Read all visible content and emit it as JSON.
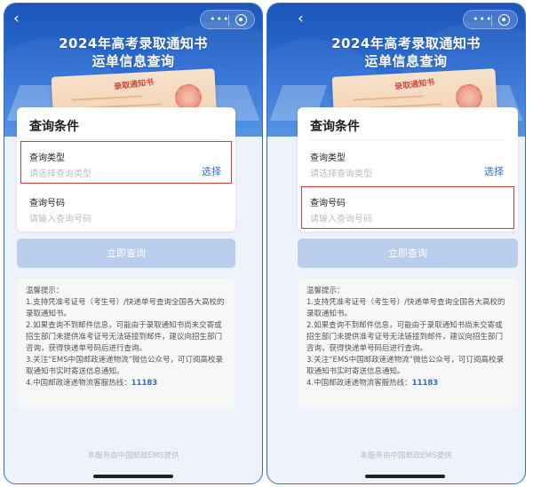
{
  "header": {
    "title_line1": "2024年高考录取通知书",
    "title_line2": "运单信息查询",
    "envelope_text": "录取通知书",
    "back_icon": "‹",
    "more_icon": "•••"
  },
  "form": {
    "card_title": "查询条件",
    "type_label": "查询类型",
    "type_placeholder": "请选择查询类型",
    "choose_label": "选择",
    "number_label": "查询号码",
    "number_placeholder": "请输入查询号码",
    "submit_label": "立即查询"
  },
  "tips": {
    "heading": "温馨提示：",
    "line1": "1.支持凭准考证号（考生号）/快递单号查询全国各大高校的录取通知书。",
    "line2": "2.如果查询不到邮件信息，可能由于录取通知书尚未交寄或招生部门未提供准考证号无法链接到邮件，建议向招生部门咨询，获得快递单号码后进行查询。",
    "line3": "3.关注“EMS中国邮政速递物流”微信公众号，可订阅高校录取通知书实时寄送信息通知。",
    "line4_prefix": "4.中国邮政速递物流客服热线：",
    "hotline": "11183"
  },
  "footer": {
    "text": "本服务由中国邮政EMS提供"
  },
  "colors": {
    "primary": "#2f6bd1",
    "highlight": "#d63a3a",
    "button_disabled": "#b9cdec"
  }
}
